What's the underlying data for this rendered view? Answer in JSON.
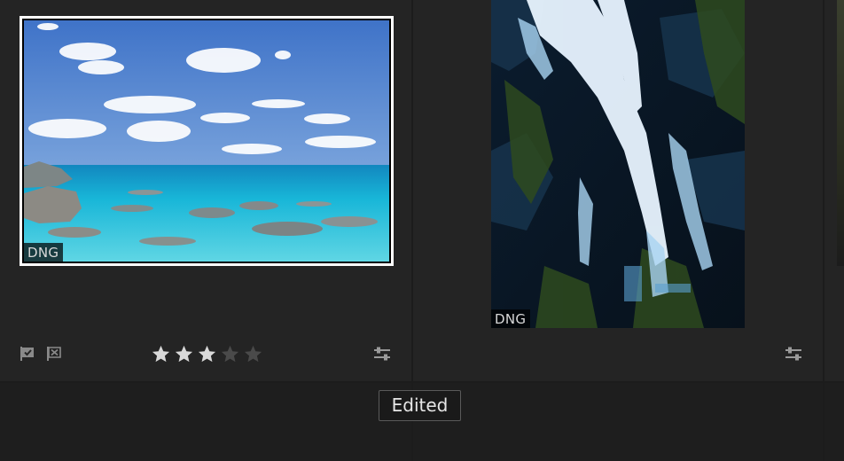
{
  "photos": [
    {
      "format_badge": "DNG",
      "selected": true,
      "rating": 3,
      "max_rating": 5
    },
    {
      "format_badge": "DNG",
      "selected": false
    }
  ],
  "tooltip": {
    "text": "Edited"
  },
  "icons": {
    "pick": "flag-pick-icon",
    "reject": "flag-reject-icon",
    "edited": "adjustments-sliders-icon",
    "star": "star-icon"
  },
  "colors": {
    "star_filled": "#d9d9d9",
    "star_empty": "#4a4a4a",
    "selection_border": "#ffffff"
  }
}
